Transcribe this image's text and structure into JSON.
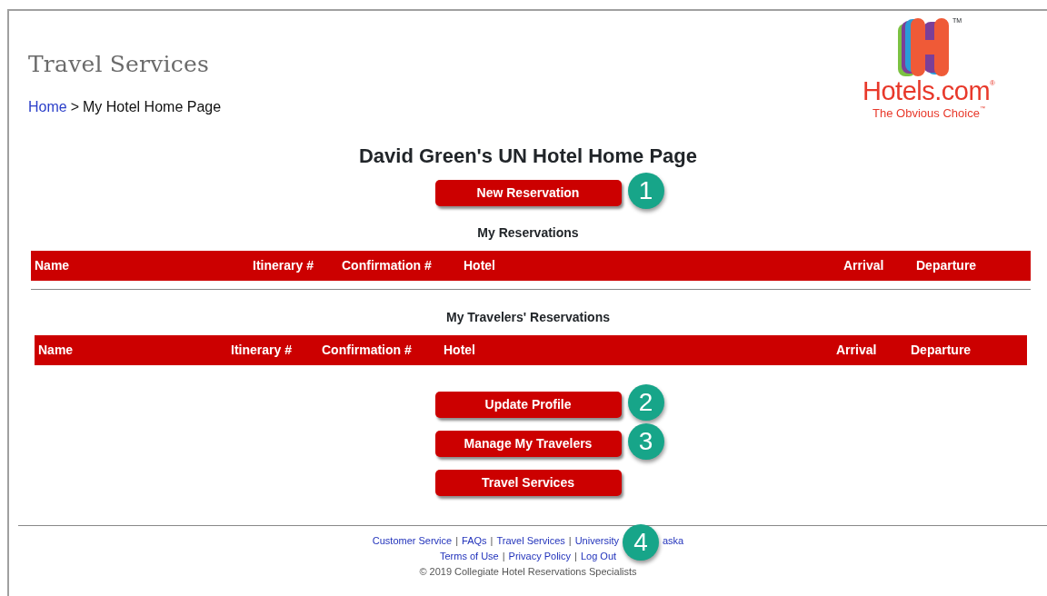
{
  "site_title": "Travel Services",
  "breadcrumb": {
    "home": "Home",
    "separator": ">",
    "current": "My Hotel Home Page"
  },
  "logo": {
    "wordmark": "Hotels.com",
    "registered": "®",
    "trademark": "TM",
    "tagline": "The Obvious Choice",
    "tagline_mark": "™"
  },
  "page_heading": "David Green's UN Hotel Home Page",
  "new_reservation": {
    "label": "New Reservation",
    "callout": "1"
  },
  "my_reservations": {
    "title": "My Reservations",
    "columns": [
      "Name",
      "Itinerary #",
      "Confirmation #",
      "Hotel",
      "Arrival",
      "Departure"
    ]
  },
  "travelers_reservations": {
    "title": "My Travelers' Reservations",
    "columns": [
      "Name",
      "Itinerary #",
      "Confirmation #",
      "Hotel",
      "Arrival",
      "Departure"
    ]
  },
  "actions": [
    {
      "label": "Update Profile",
      "callout": "2"
    },
    {
      "label": "Manage My Travelers",
      "callout": "3"
    },
    {
      "label": "Travel Services"
    }
  ],
  "footer": {
    "separator": "|",
    "links_row_1": [
      "Customer Service",
      "FAQs",
      "Travel Services",
      "University",
      "aska"
    ],
    "links_row_2": [
      "Terms of Use",
      "Privacy Policy",
      "Log Out"
    ],
    "callout": "4",
    "copyright": "© 2019 Collegiate Hotel Reservations Specialists"
  }
}
